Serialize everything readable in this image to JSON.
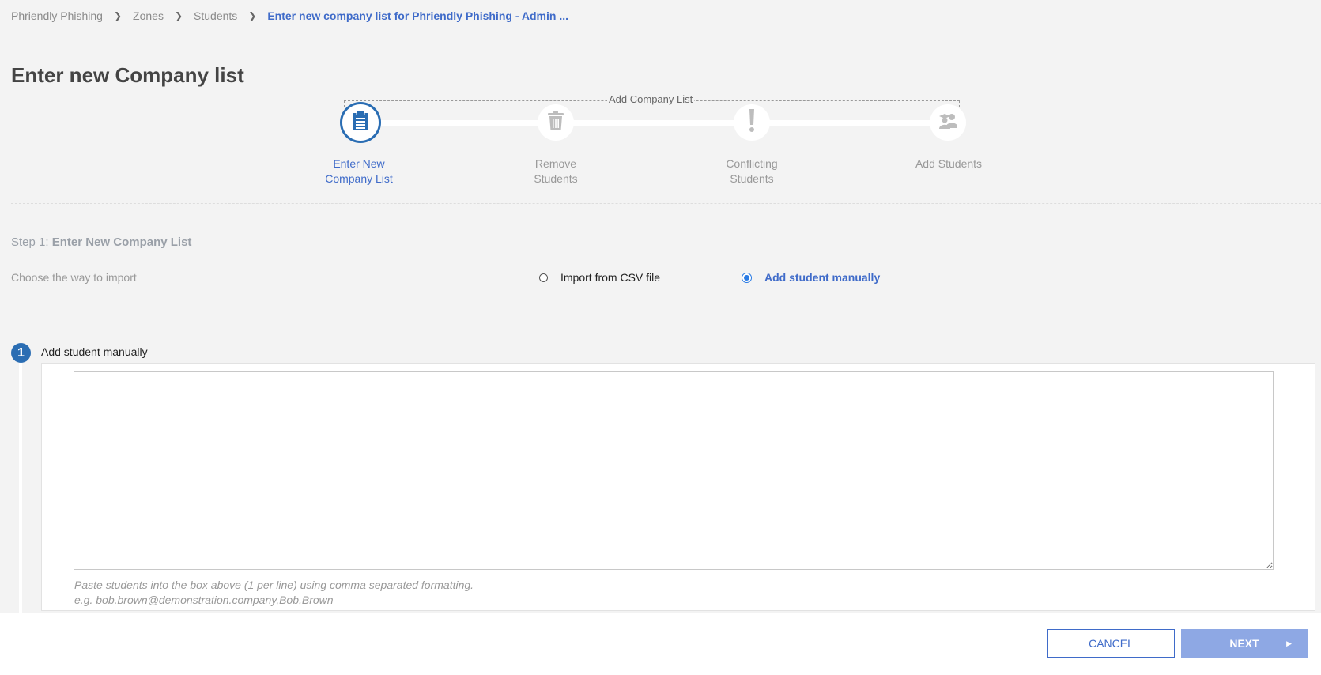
{
  "breadcrumb": {
    "items": [
      "Phriendly Phishing",
      "Zones",
      "Students"
    ],
    "current": "Enter new company list for Phriendly Phishing - Admin ..."
  },
  "page": {
    "title": "Enter new Company list"
  },
  "stepper": {
    "group_label": "Add Company List",
    "steps": [
      {
        "label_line1": "Enter New",
        "label_line2": "Company List",
        "icon": "clipboard-icon",
        "active": true
      },
      {
        "label_line1": "Remove",
        "label_line2": "Students",
        "icon": "trash-icon",
        "active": false
      },
      {
        "label_line1": "Conflicting",
        "label_line2": "Students",
        "icon": "exclamation-icon",
        "active": false
      },
      {
        "label_line1": "Add Students",
        "label_line2": "",
        "icon": "users-icon",
        "active": false
      }
    ]
  },
  "step": {
    "prefix": "Step 1:",
    "name": "Enter New Company List",
    "choose_label": "Choose the way to import"
  },
  "import_options": {
    "csv_label": "Import from CSV file",
    "manual_label": "Add student manually",
    "selected": "manual"
  },
  "section": {
    "number": "1",
    "title": "Add student manually",
    "textarea_value": "",
    "hint_line1": "Paste students into the box above (1 per line) using comma separated formatting.",
    "hint_line2": "e.g. bob.brown@demonstration.company,Bob,Brown"
  },
  "footer": {
    "cancel_label": "CANCEL",
    "next_label": "NEXT"
  },
  "colors": {
    "accent": "#3f6bc9",
    "step_active": "#2a6db3",
    "next_disabled": "#8ea8e4"
  }
}
